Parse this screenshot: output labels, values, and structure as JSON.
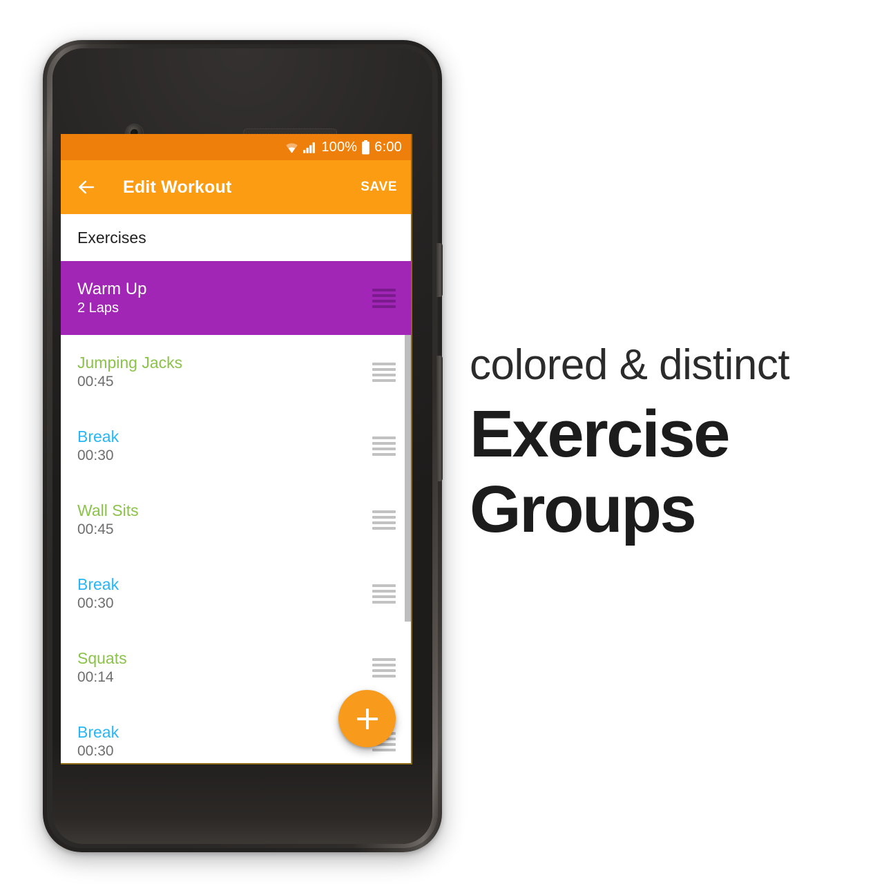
{
  "status_bar": {
    "wifi_icon": "wifi-icon",
    "signal_icon": "signal-bars-icon",
    "battery_percent": "100%",
    "battery_icon": "battery-full-icon",
    "clock": "6:00",
    "background_color": "#EE7F0B"
  },
  "app_bar": {
    "back_icon": "back-arrow-icon",
    "title": "Edit Workout",
    "save_label": "SAVE",
    "background_color": "#FB9C12"
  },
  "content": {
    "section_header": "Exercises",
    "group": {
      "name": "Warm Up",
      "detail": "2 Laps",
      "color": "#A226B5",
      "handle_icon": "drag-handle-icon"
    },
    "exercises": [
      {
        "name": "Jumping Jacks",
        "duration": "00:45",
        "type": "exercise",
        "color": "#8BC34A"
      },
      {
        "name": "Break",
        "duration": "00:30",
        "type": "break",
        "color": "#29B6F6"
      },
      {
        "name": "Wall Sits",
        "duration": "00:45",
        "type": "exercise",
        "color": "#8BC34A"
      },
      {
        "name": "Break",
        "duration": "00:30",
        "type": "break",
        "color": "#29B6F6"
      },
      {
        "name": "Squats",
        "duration": "00:14",
        "type": "exercise",
        "color": "#8BC34A"
      },
      {
        "name": "Break",
        "duration": "00:30",
        "type": "break",
        "color": "#29B6F6"
      }
    ]
  },
  "fab": {
    "icon": "plus-icon",
    "color": "#F89A1C"
  },
  "caption": {
    "line1": "colored & distinct",
    "line2": "Exercise",
    "line3": "Groups"
  },
  "device": {
    "camera_icon": "front-camera-icon",
    "speaker_icon": "earpiece-speaker-icon",
    "sensor_icon": "proximity-sensor-icon",
    "power_button": "power-button",
    "volume_button": "volume-rocker-button"
  }
}
